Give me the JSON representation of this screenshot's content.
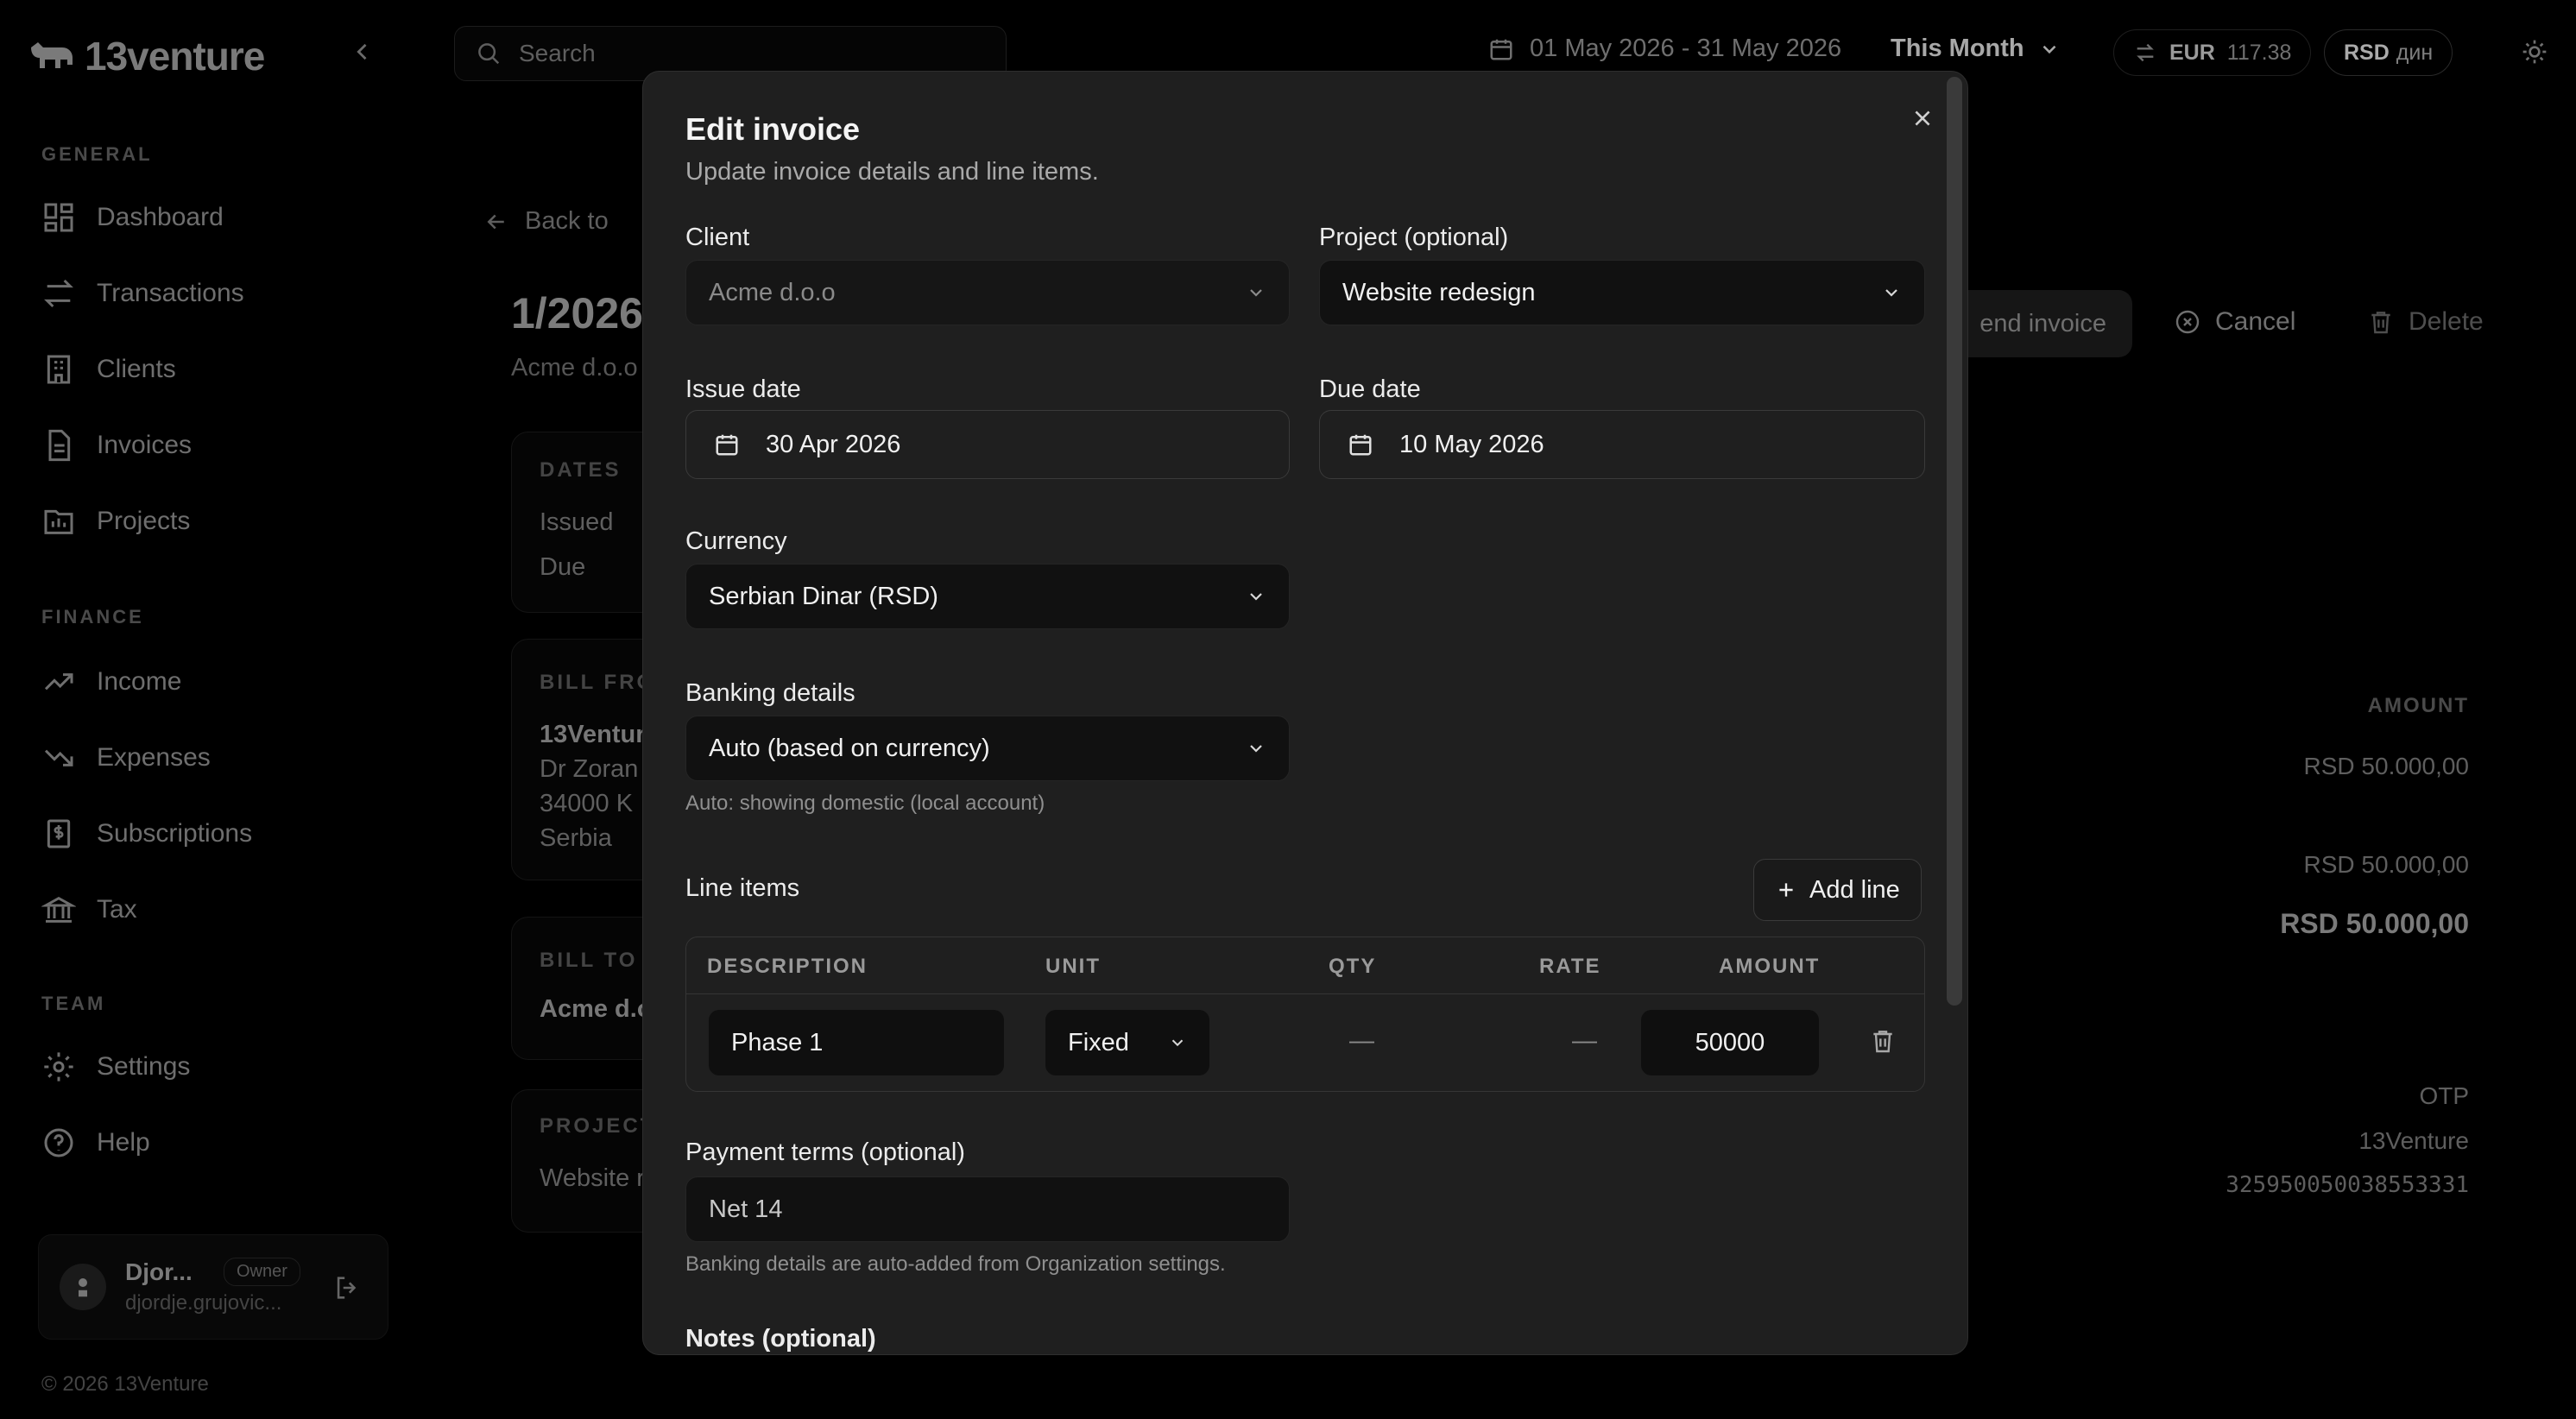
{
  "app": {
    "brand": "13venture",
    "search_placeholder": "Search",
    "date_range": "01 May 2026 - 31 May 2026",
    "period": "This Month",
    "fx": {
      "label": "EUR",
      "value": "117.38"
    },
    "currency": {
      "code": "RSD",
      "symbol": "дин"
    },
    "copyright": "© 2026 13Venture"
  },
  "sidebar": {
    "sections": [
      {
        "title": "GENERAL",
        "items": [
          "Dashboard",
          "Transactions",
          "Clients",
          "Invoices",
          "Projects"
        ]
      },
      {
        "title": "FINANCE",
        "items": [
          "Income",
          "Expenses",
          "Subscriptions",
          "Tax"
        ]
      },
      {
        "title": "TEAM",
        "items": [
          "Settings",
          "Help"
        ]
      }
    ],
    "user": {
      "name": "Djor...",
      "email": "djordje.grujovic...",
      "role": "Owner"
    }
  },
  "page": {
    "back_label": "Back to",
    "invoice_number": "1/2026",
    "client_name": "Acme d.o.o",
    "actions": {
      "send": "end invoice",
      "cancel": "Cancel",
      "delete": "Delete"
    },
    "cards": {
      "dates": {
        "label": "DATES",
        "issued": "Issued",
        "due": "Due"
      },
      "bill_from": {
        "label": "BILL FROM",
        "name": "13Ventur",
        "lines": [
          "Dr Zoran",
          "34000 K",
          "Serbia"
        ]
      },
      "bill_to": {
        "label": "BILL TO",
        "name": "Acme d.o"
      },
      "project": {
        "label": "PROJECT",
        "name": "Website r"
      }
    },
    "amount_header": "AMOUNT",
    "amounts": {
      "line": "RSD 50.000,00",
      "subtotal": "RSD 50.000,00",
      "total": "RSD 50.000,00"
    },
    "bank": {
      "bank_name": "OTP",
      "holder": "13Venture",
      "account": "325950050038553331"
    }
  },
  "modal": {
    "title": "Edit invoice",
    "subtitle": "Update invoice details and line items.",
    "client": {
      "label": "Client",
      "value": "Acme d.o.o"
    },
    "project": {
      "label": "Project (optional)",
      "value": "Website redesign"
    },
    "issue_date": {
      "label": "Issue date",
      "value": "30 Apr 2026"
    },
    "due_date": {
      "label": "Due date",
      "value": "10 May 2026"
    },
    "currency": {
      "label": "Currency",
      "value": "Serbian Dinar (RSD)"
    },
    "banking": {
      "label": "Banking details",
      "value": "Auto (based on currency)",
      "hint": "Auto: showing domestic (local account)"
    },
    "line_items": {
      "label": "Line items",
      "add_label": "Add line",
      "columns": [
        "DESCRIPTION",
        "UNIT",
        "QTY",
        "RATE",
        "AMOUNT"
      ],
      "rows": [
        {
          "description": "Phase 1",
          "unit": "Fixed",
          "qty": "—",
          "rate": "—",
          "amount": "50000"
        }
      ]
    },
    "payment_terms": {
      "label": "Payment terms (optional)",
      "value": "Net 14",
      "hint": "Banking details are auto-added from Organization settings."
    },
    "notes": {
      "label": "Notes (optional)"
    }
  }
}
